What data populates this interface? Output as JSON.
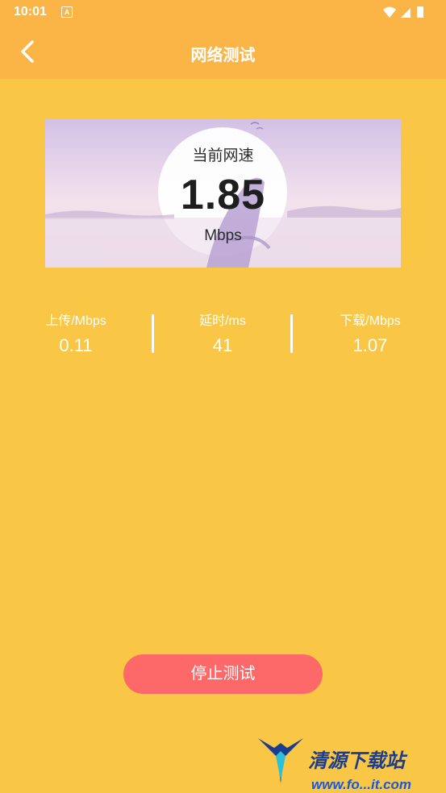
{
  "status_bar": {
    "time": "10:01"
  },
  "app_bar": {
    "title": "网络测试"
  },
  "speed": {
    "label": "当前网速",
    "value": "1.85",
    "unit": "Mbps"
  },
  "stats": [
    {
      "label": "上传/Mbps",
      "value": "0.11"
    },
    {
      "label": "延时/ms",
      "value": "41"
    },
    {
      "label": "下载/Mbps",
      "value": "1.07"
    }
  ],
  "stop_button": {
    "label": "停止测试"
  },
  "watermark": {
    "text": "清源下载站",
    "url": "www.fo...it.com"
  },
  "colors": {
    "background": "#F9C645",
    "header": "#FBB446",
    "button": "#FD6869"
  }
}
